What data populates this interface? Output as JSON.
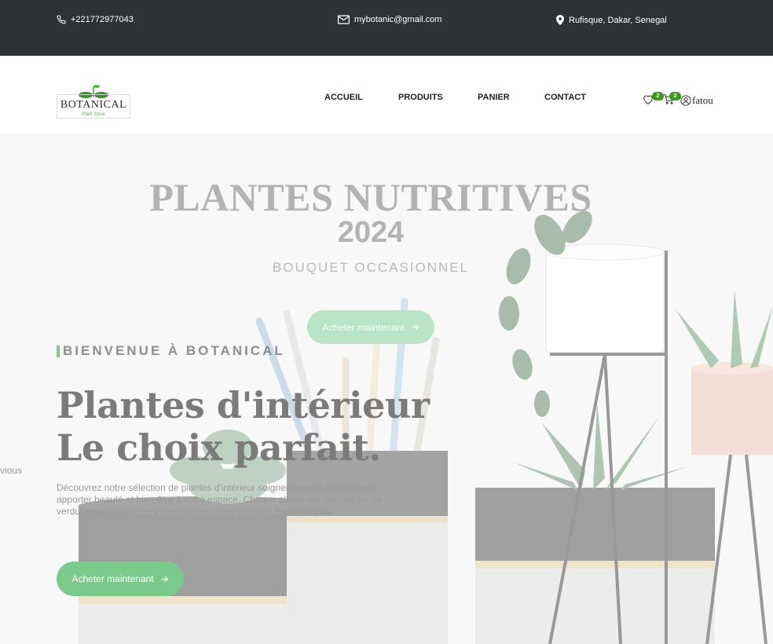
{
  "topbar": {
    "phone": "+221772977043",
    "email": "mybotanic@gmail.com",
    "address": "Rufisque, Dakar, Senegal"
  },
  "logo": {
    "name": "BOTANICAL",
    "tagline": "Plant Store"
  },
  "nav": [
    {
      "label": "ACCUEIL"
    },
    {
      "label": "PRODUITS"
    },
    {
      "label": "PANIER"
    },
    {
      "label": "CONTACT"
    }
  ],
  "header": {
    "wishlist_count": "2",
    "cart_count": "2",
    "user_name": "fatou"
  },
  "hero": {
    "slide_title": "PLANTES NUTRITIVES",
    "slide_year": "2024",
    "slide_subtitle": "BOUQUET OCCASIONNEL",
    "slide_button": "Acheter maintenant",
    "kicker": "BIENVENUE À BOTANICAL",
    "headline_line1": "Plantes d'intérieur",
    "headline_line2": "Le choix parfait.",
    "description": "Découvrez notre sélection de plantes d'intérieur soigneusement choisies pour apporter beauté et bien-être à votre espace. Chaque plante est une touche de verdure qui transforme votre maison en un véritable havre de paix.",
    "cta_button": "Acheter maintenant",
    "prev_label": "vious"
  },
  "colors": {
    "topbar_bg": "#2f3234",
    "accent_green": "#7cc98c",
    "badge_green": "#3c9a1b"
  }
}
